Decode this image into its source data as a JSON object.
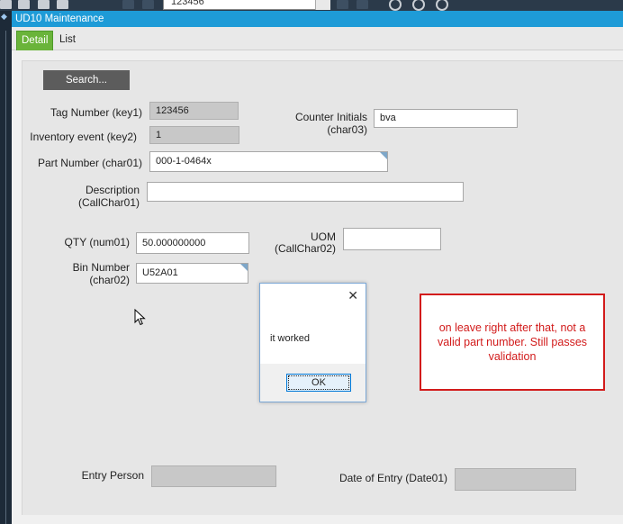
{
  "toolbar": {
    "record_value": "123456"
  },
  "window": {
    "title": "UD10 Maintenance"
  },
  "tabs": [
    {
      "label": "Detail",
      "active": true
    },
    {
      "label": "List",
      "active": false
    }
  ],
  "form": {
    "search_label": "Search...",
    "tag_number": {
      "label": "Tag Number (key1)",
      "value": "123456"
    },
    "inventory_event": {
      "label": "Inventory event (key2)",
      "value": "1"
    },
    "counter_initials": {
      "label_line1": "Counter Initials",
      "label_line2": "(char03)",
      "value": "bva"
    },
    "part_number": {
      "label": "Part Number (char01)",
      "value": "000-1-0464x"
    },
    "description": {
      "label_line1": "Description",
      "label_line2": "(CallChar01)",
      "value": ""
    },
    "qty": {
      "label": "QTY (num01)",
      "value": "50.000000000"
    },
    "uom": {
      "label_line1": "UOM",
      "label_line2": "(CallChar02)",
      "value": ""
    },
    "bin_number": {
      "label_line1": "Bin Number",
      "label_line2": "(char02)",
      "value": "U52A01"
    },
    "entry_person": {
      "label": "Entry Person",
      "value": ""
    },
    "date_of_entry": {
      "label": "Date of Entry (Date01)",
      "value": ""
    }
  },
  "dialog": {
    "message": "it worked",
    "ok_label": "OK",
    "close_glyph": "✕"
  },
  "annotation": {
    "text": "on leave right after that, not a valid part number. Still passes validation"
  },
  "colors": {
    "titlebar": "#1e9bd7",
    "active_tab": "#6ab43a",
    "annotation": "#d21b1b"
  }
}
